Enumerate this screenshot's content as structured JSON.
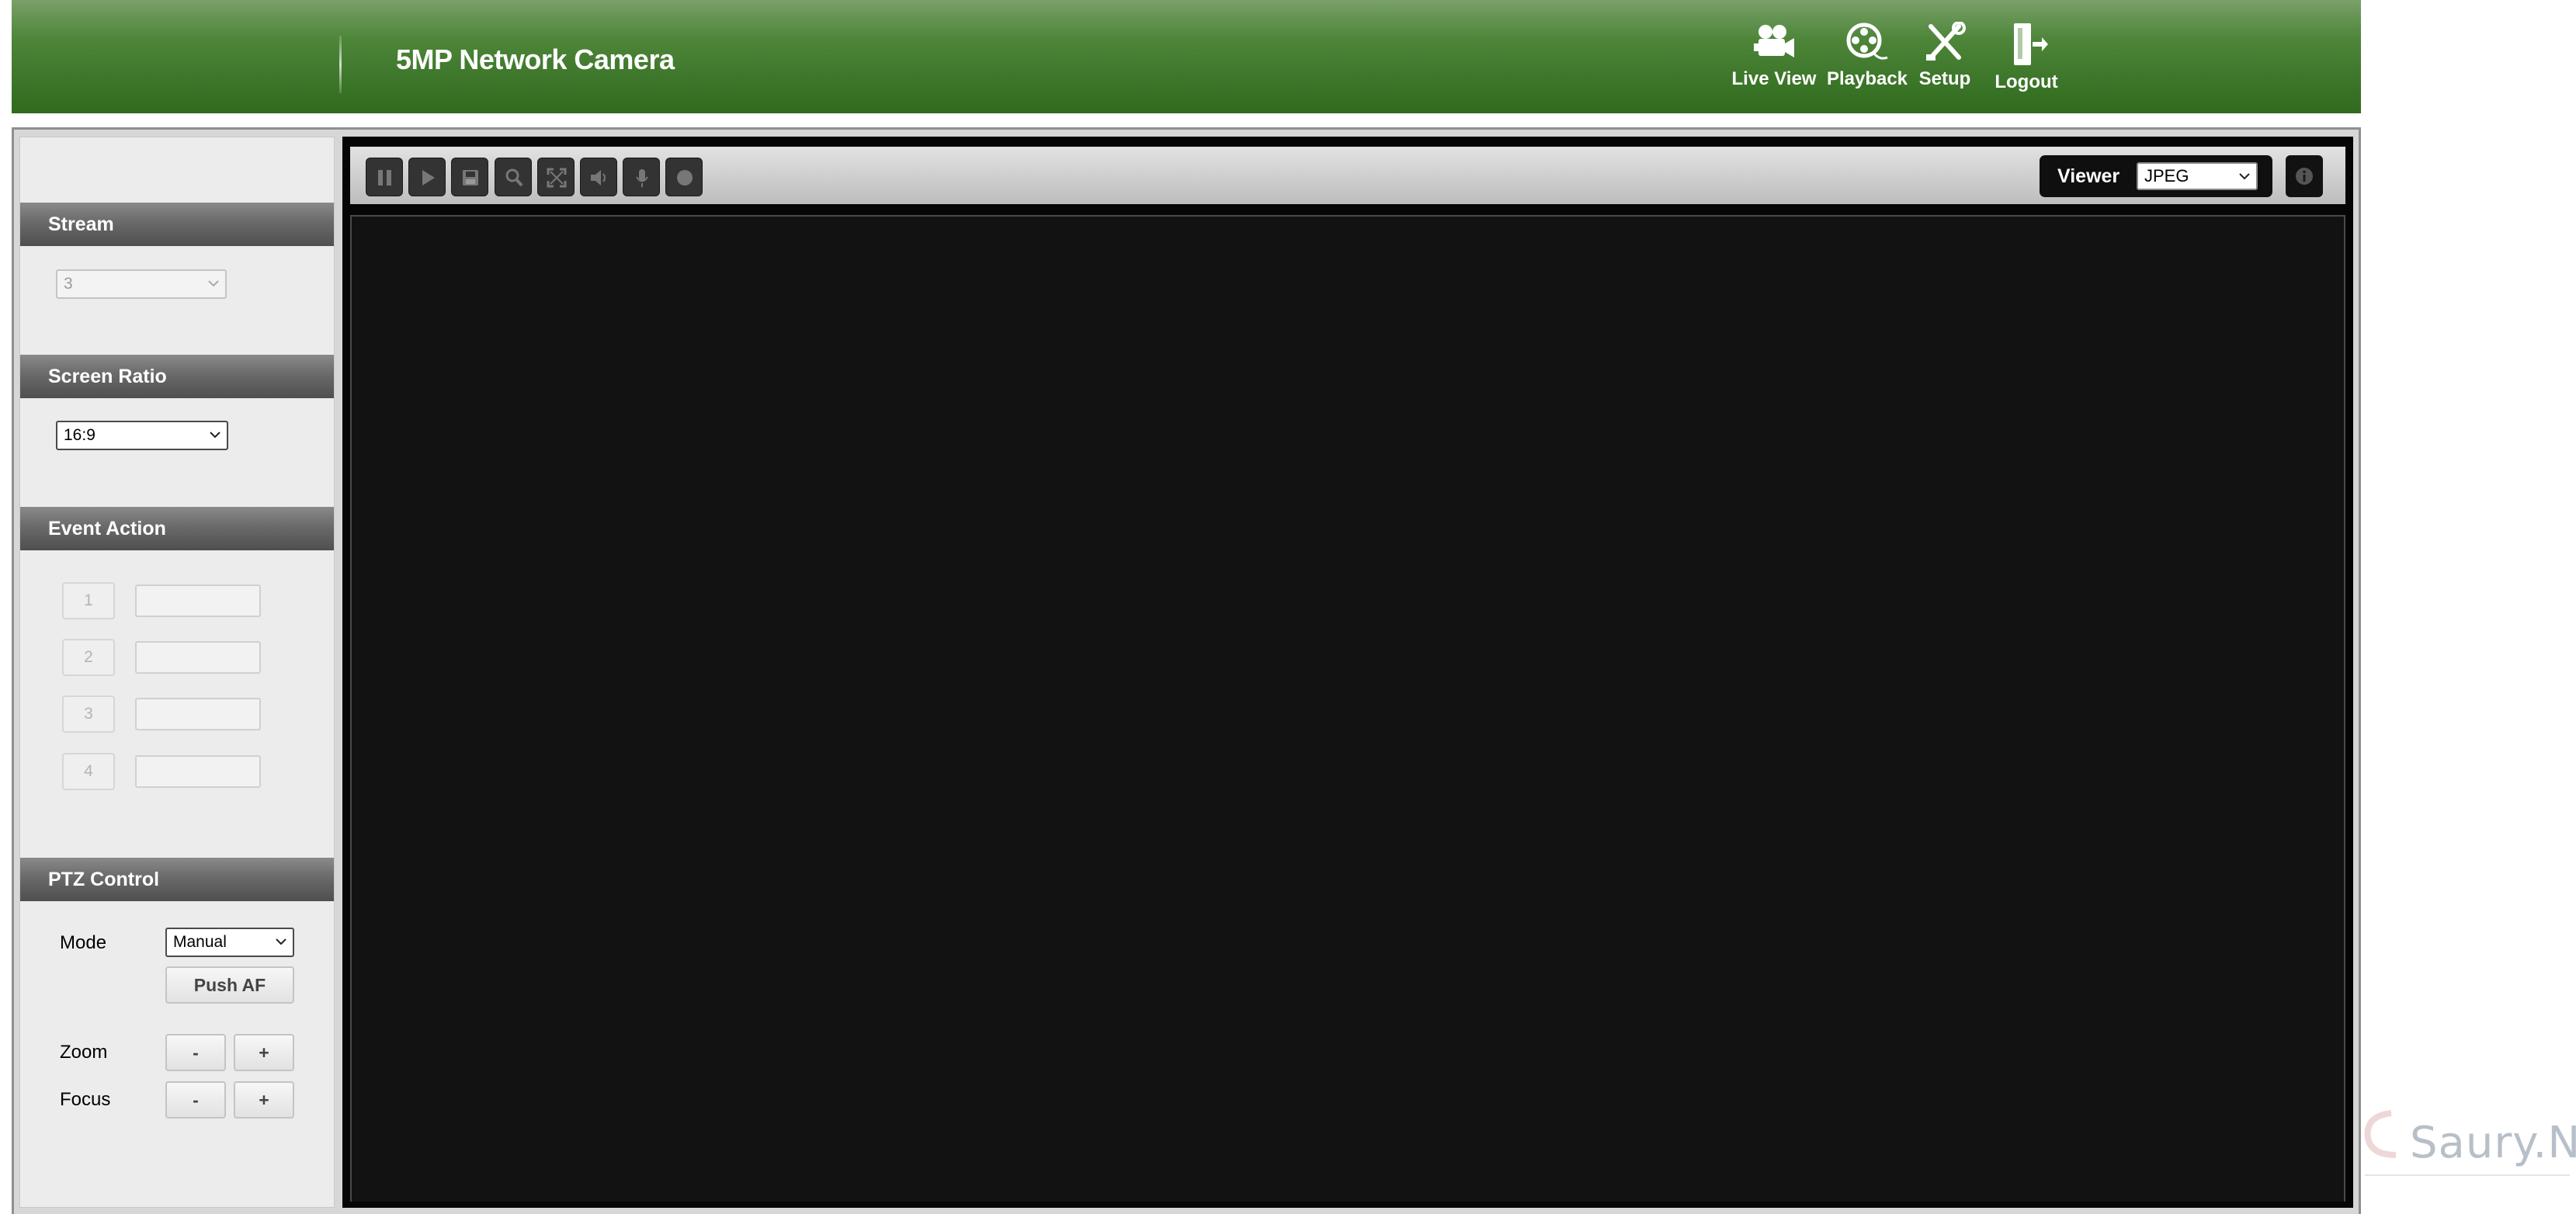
{
  "header": {
    "title": "5MP Network Camera",
    "nav": [
      {
        "label": "Live View",
        "icon": "video-camera-icon"
      },
      {
        "label": "Playback",
        "icon": "film-reel-icon"
      },
      {
        "label": "Setup",
        "icon": "tools-icon"
      },
      {
        "label": "Logout",
        "icon": "logout-door-icon"
      }
    ]
  },
  "sidebar": {
    "stream": {
      "title": "Stream",
      "value": "3"
    },
    "screen_ratio": {
      "title": "Screen Ratio",
      "value": "16:9"
    },
    "event_action": {
      "title": "Event Action",
      "buttons": [
        "1",
        "2",
        "3",
        "4"
      ]
    },
    "ptz": {
      "title": "PTZ Control",
      "mode_label": "Mode",
      "mode_value": "Manual",
      "push_af": "Push AF",
      "zoom_label": "Zoom",
      "focus_label": "Focus",
      "minus": "-",
      "plus": "+"
    }
  },
  "toolbar": {
    "buttons": [
      "pause-icon",
      "play-icon",
      "save-icon",
      "zoom-icon",
      "fullscreen-icon",
      "speaker-icon",
      "microphone-icon",
      "record-icon"
    ],
    "viewer_label": "Viewer",
    "viewer_value": "JPEG"
  },
  "watermark": {
    "text": "Saury.Net"
  },
  "colors": {
    "header_green": "#3f7a2b",
    "section_header": "#6a6a6a",
    "video_bg": "#121212"
  }
}
